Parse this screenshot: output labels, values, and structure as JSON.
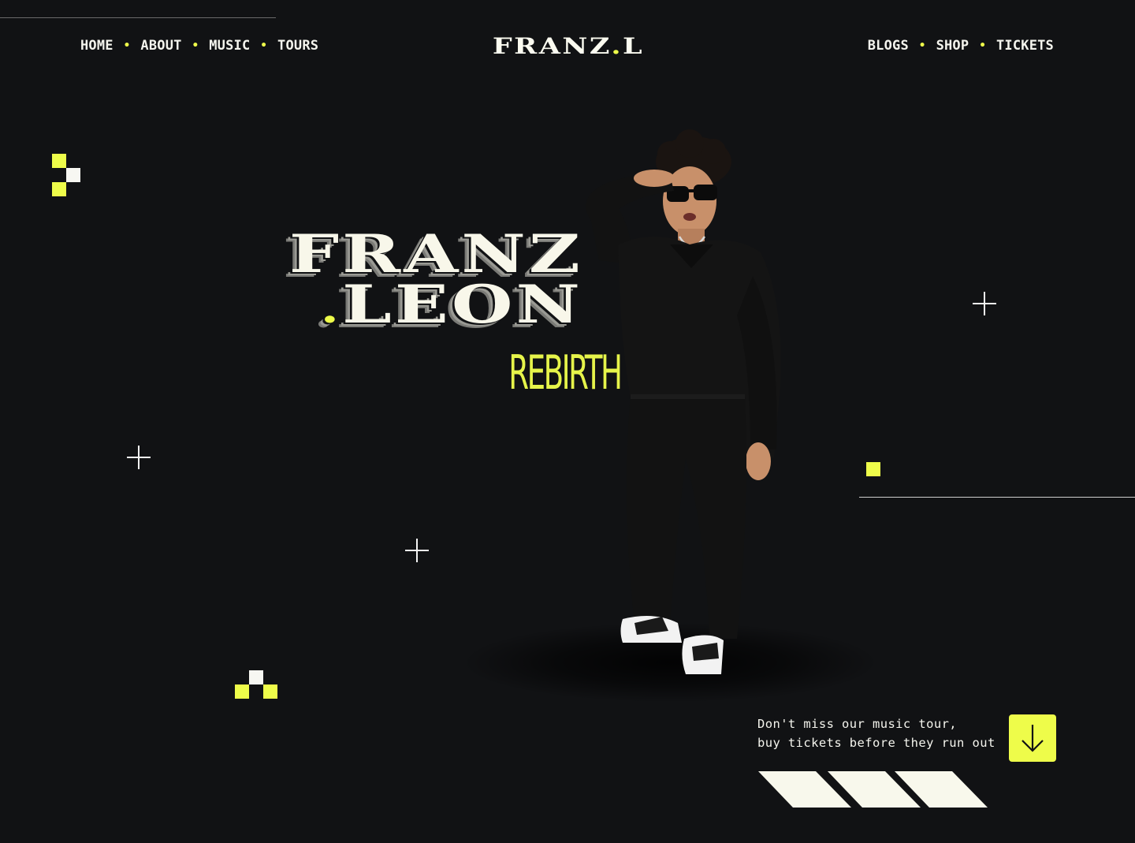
{
  "nav": {
    "left": [
      "HOME",
      "ABOUT",
      "MUSIC",
      "TOURS"
    ],
    "right": [
      "BLOGS",
      "SHOP",
      "TICKETS"
    ],
    "separator": "•"
  },
  "logo": {
    "main": "FRANZ",
    "dot": ".",
    "suffix": "L"
  },
  "hero": {
    "line1": "FRANZ",
    "line2_dot": ".",
    "line2": "LEON",
    "subtitle": "REBIRTH"
  },
  "cta": {
    "line1": "Don't miss our music tour,",
    "line2": "buy tickets before they run out",
    "button_icon": "arrow-down-icon"
  },
  "colors": {
    "background": "#111214",
    "accent": "#eefc4a",
    "text": "#f5f5ee"
  }
}
